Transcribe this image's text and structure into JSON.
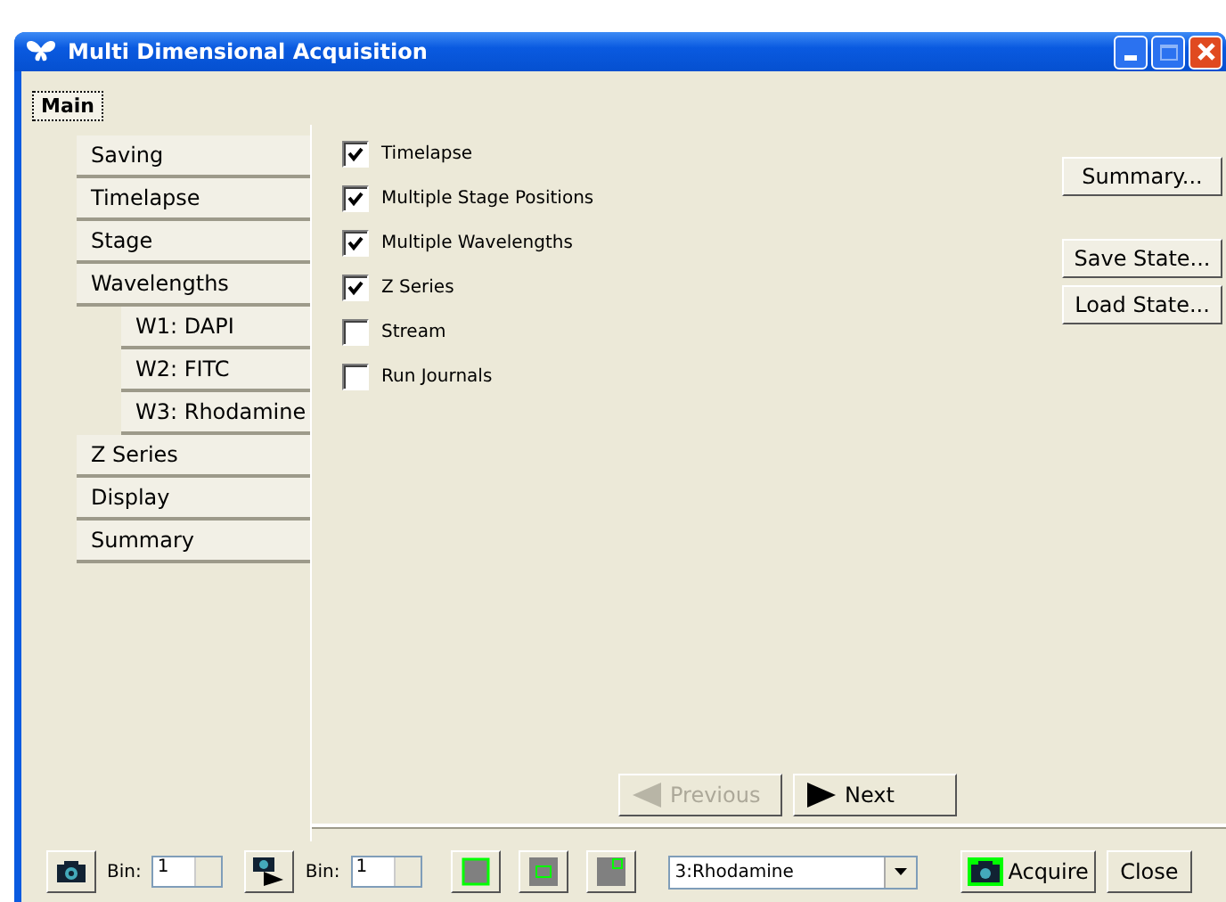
{
  "window": {
    "title": "Multi Dimensional Acquisition"
  },
  "tab": {
    "label": "Main",
    "selected": true
  },
  "nav": [
    {
      "label": "Saving",
      "selected": false
    },
    {
      "label": "Timelapse",
      "selected": false
    },
    {
      "label": "Stage",
      "selected": false
    },
    {
      "label": "Wavelengths",
      "selected": false,
      "children": [
        {
          "label": "W1: DAPI",
          "selected": false
        },
        {
          "label": "W2: FITC",
          "selected": false
        },
        {
          "label": "W3: Rhodamine",
          "selected": false
        }
      ]
    },
    {
      "label": "Z Series",
      "selected": false
    },
    {
      "label": "Display",
      "selected": false
    },
    {
      "label": "Summary",
      "selected": false
    }
  ],
  "options": [
    {
      "label": "Timelapse",
      "checked": true
    },
    {
      "label": "Multiple Stage Positions",
      "checked": true
    },
    {
      "label": "Multiple Wavelengths",
      "checked": true
    },
    {
      "label": "Z Series",
      "checked": true
    },
    {
      "label": "Stream",
      "checked": false
    },
    {
      "label": "Run Journals",
      "checked": false
    }
  ],
  "side_buttons": [
    "Summary...",
    "Save State...",
    "Load State..."
  ],
  "wizard": [
    {
      "label": "Previous",
      "kind": "prev",
      "disabled": true
    },
    {
      "label": "Next",
      "kind": "next",
      "disabled": false
    }
  ],
  "toolbar": {
    "snap_bin": {
      "label": "Bin:",
      "value": "1"
    },
    "stream_bin": {
      "label": "Bin:",
      "value": "1"
    },
    "wavelength": "3:Rhodamine",
    "acquire": "Acquire",
    "close": "Close"
  }
}
